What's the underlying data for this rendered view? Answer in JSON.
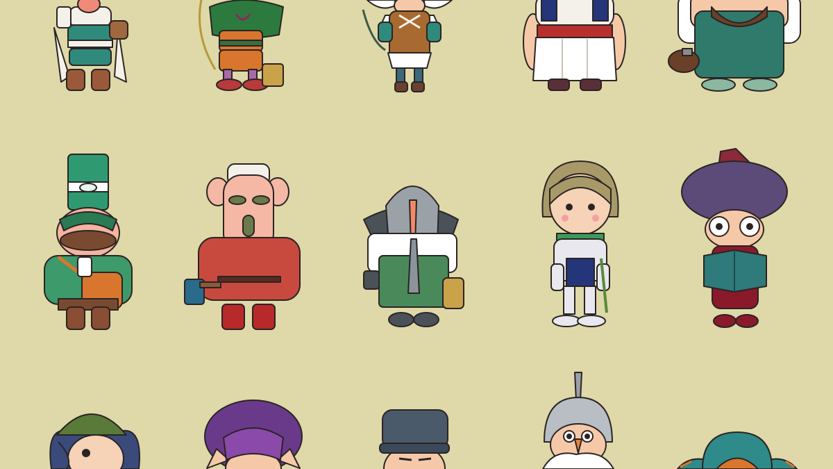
{
  "palette": {
    "background": "#dfd8a8",
    "outline": "#2a2424",
    "skin": "#f5c9a8",
    "skin_pink": "#f6b8b0",
    "teal": "#2f8a7c",
    "green": "#3d8a58",
    "orange": "#d9762e",
    "red": "#b83a3a",
    "purple": "#5c4a78",
    "grey": "#8e9498",
    "brown": "#7a4e34",
    "white": "#ffffff"
  },
  "characters": [
    {
      "row": 1,
      "col": 1,
      "icon": "traveler-with-scroll-and-bag"
    },
    {
      "row": 1,
      "col": 2,
      "icon": "archer-with-green-cloak-and-bucket"
    },
    {
      "row": 1,
      "col": 3,
      "icon": "winged-helmet-archer-girl"
    },
    {
      "row": 1,
      "col": 4,
      "icon": "large-villager-white-apron-red-sash"
    },
    {
      "row": 1,
      "col": 5,
      "icon": "bearded-worker-teal-overalls-hammer"
    },
    {
      "row": 2,
      "col": 1,
      "icon": "mustached-postman-green-hat-orange-satchel"
    },
    {
      "row": 2,
      "col": 2,
      "icon": "big-eared-woodcutter-red-tunic-axe"
    },
    {
      "row": 2,
      "col": 3,
      "icon": "grey-hooded-old-woman-basket"
    },
    {
      "row": 2,
      "col": 4,
      "icon": "young-knight-armor-sword"
    },
    {
      "row": 2,
      "col": 5,
      "icon": "scholar-purple-turban-glasses-book"
    },
    {
      "row": 3,
      "col": 1,
      "icon": "girl-green-beanie-blue-hair"
    },
    {
      "row": 3,
      "col": 2,
      "icon": "purple-curly-hair-elf-ears"
    },
    {
      "row": 3,
      "col": 3,
      "icon": "man-grey-flat-cap"
    },
    {
      "row": 3,
      "col": 4,
      "icon": "old-soldier-spiked-helmet-white-mustache"
    },
    {
      "row": 3,
      "col": 5,
      "icon": "teal-horned-hat-orange-face"
    }
  ]
}
